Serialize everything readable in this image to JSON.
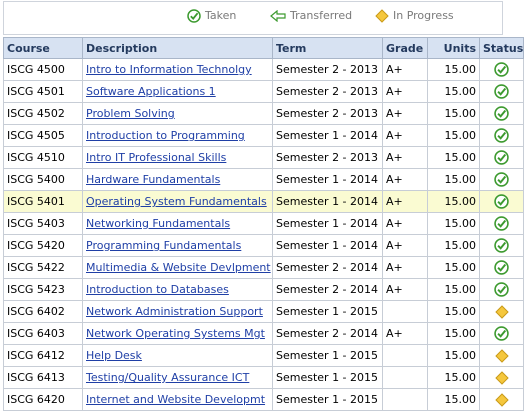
{
  "legend": {
    "taken": "Taken",
    "transferred": "Transferred",
    "in_progress": "In Progress"
  },
  "columns": {
    "course": "Course",
    "description": "Description",
    "term": "Term",
    "grade": "Grade",
    "units": "Units",
    "status": "Status"
  },
  "rows": [
    {
      "course": "ISCG 4500",
      "description": "Intro to Information Technolgy",
      "term": "Semester 2 - 2013",
      "grade": "A+",
      "units": "15.00",
      "status": "taken",
      "status_icon": "check-circle-icon"
    },
    {
      "course": "ISCG 4501",
      "description": "Software Applications 1",
      "term": "Semester 2 - 2013",
      "grade": "A+",
      "units": "15.00",
      "status": "taken",
      "status_icon": "check-circle-icon"
    },
    {
      "course": "ISCG 4502",
      "description": "Problem Solving",
      "term": "Semester 2 - 2013",
      "grade": "A+",
      "units": "15.00",
      "status": "taken",
      "status_icon": "check-circle-icon"
    },
    {
      "course": "ISCG 4505",
      "description": "Introduction to Programming",
      "term": "Semester 1 - 2014",
      "grade": "A+",
      "units": "15.00",
      "status": "taken",
      "status_icon": "check-circle-icon"
    },
    {
      "course": "ISCG 4510",
      "description": "Intro IT Professional Skills",
      "term": "Semester 2 - 2013",
      "grade": "A+",
      "units": "15.00",
      "status": "taken",
      "status_icon": "check-circle-icon"
    },
    {
      "course": "ISCG 5400",
      "description": "Hardware Fundamentals",
      "term": "Semester 1 - 2014",
      "grade": "A+",
      "units": "15.00",
      "status": "taken",
      "status_icon": "check-circle-icon"
    },
    {
      "course": "ISCG 5401",
      "description": "Operating System Fundamentals",
      "term": "Semester 1 - 2014",
      "grade": "A+",
      "units": "15.00",
      "status": "taken",
      "status_icon": "check-circle-icon"
    },
    {
      "course": "ISCG 5403",
      "description": "Networking Fundamentals",
      "term": "Semester 1 - 2014",
      "grade": "A+",
      "units": "15.00",
      "status": "taken",
      "status_icon": "check-circle-icon"
    },
    {
      "course": "ISCG 5420",
      "description": "Programming Fundamentals",
      "term": "Semester 1 - 2014",
      "grade": "A+",
      "units": "15.00",
      "status": "taken",
      "status_icon": "check-circle-icon"
    },
    {
      "course": "ISCG 5422",
      "description": "Multimedia & Website Devlpment",
      "term": "Semester 2 - 2014",
      "grade": "A+",
      "units": "15.00",
      "status": "taken",
      "status_icon": "check-circle-icon"
    },
    {
      "course": "ISCG 5423",
      "description": "Introduction to Databases",
      "term": "Semester 2 - 2014",
      "grade": "A+",
      "units": "15.00",
      "status": "taken",
      "status_icon": "check-circle-icon"
    },
    {
      "course": "ISCG 6402",
      "description": "Network Administration Support",
      "term": "Semester 1 - 2015",
      "grade": "",
      "units": "15.00",
      "status": "in_progress",
      "status_icon": "in-progress-diamond-icon"
    },
    {
      "course": "ISCG 6403",
      "description": "Network Operating Systems Mgt",
      "term": "Semester 2 - 2014",
      "grade": "A+",
      "units": "15.00",
      "status": "taken",
      "status_icon": "check-circle-icon"
    },
    {
      "course": "ISCG 6412",
      "description": "Help Desk",
      "term": "Semester 1 - 2015",
      "grade": "",
      "units": "15.00",
      "status": "in_progress",
      "status_icon": "in-progress-diamond-icon"
    },
    {
      "course": "ISCG 6413",
      "description": "Testing/Quality Assurance ICT",
      "term": "Semester 1 - 2015",
      "grade": "",
      "units": "15.00",
      "status": "in_progress",
      "status_icon": "in-progress-diamond-icon"
    },
    {
      "course": "ISCG 6420",
      "description": "Internet and Website Developmt",
      "term": "Semester 1 - 2015",
      "grade": "",
      "units": "15.00",
      "status": "in_progress",
      "status_icon": "in-progress-diamond-icon"
    }
  ],
  "highlighted_row": 6,
  "colors": {
    "header_bg": "#d7e2f2",
    "link": "#1f3fa6",
    "taken_green": "#3c9a2f",
    "in_progress_yellow": "#f5c73d",
    "highlight_row": "#fafbd2"
  }
}
